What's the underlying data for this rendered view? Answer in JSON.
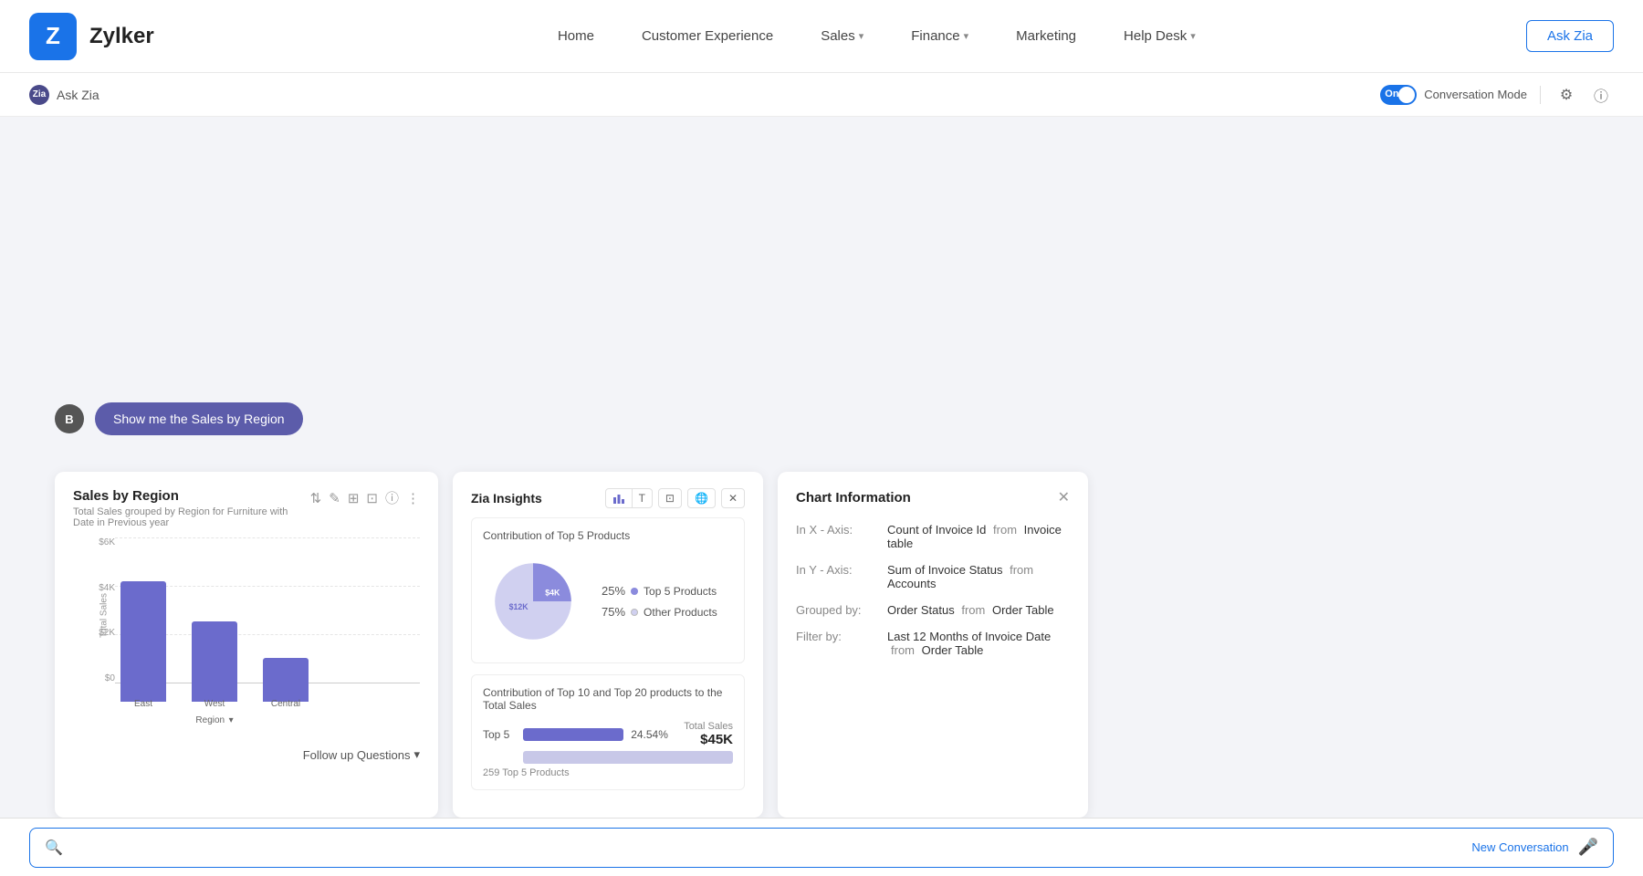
{
  "app": {
    "logo_letter": "Z",
    "name": "Zylker"
  },
  "nav": {
    "items": [
      {
        "label": "Home",
        "has_dropdown": false
      },
      {
        "label": "Customer Experience",
        "has_dropdown": false
      },
      {
        "label": "Sales",
        "has_dropdown": true
      },
      {
        "label": "Finance",
        "has_dropdown": true
      },
      {
        "label": "Marketing",
        "has_dropdown": false
      },
      {
        "label": "Help Desk",
        "has_dropdown": true
      }
    ],
    "ask_zia_btn": "Ask Zia"
  },
  "subheader": {
    "label": "Ask Zia",
    "toggle_on": "On",
    "conv_mode_label": "Conversation Mode"
  },
  "chat": {
    "user_initial": "B",
    "user_message": "Show me the Sales by Region"
  },
  "sales_card": {
    "title": "Sales by Region",
    "subtitle": "Total Sales grouped by Region for Furniture with Date in Previous year",
    "y_labels": [
      "$6K",
      "$4K",
      "$2K",
      "$0"
    ],
    "y_axis_title": "Total Sales",
    "bars": [
      {
        "label": "East",
        "height_pct": 82
      },
      {
        "label": "West\nRegion",
        "height_pct": 55
      },
      {
        "label": "Central",
        "height_pct": 30
      }
    ],
    "follow_up_label": "Follow up Questions"
  },
  "zia_insights": {
    "title": "Zia Insights",
    "pie_section_title": "Contribution of Top 5 Products",
    "pie_segments": [
      {
        "label": "Top 5 Products",
        "pct": 25,
        "color": "#8b8bdd",
        "value": "$4K"
      },
      {
        "label": "Other Products",
        "pct": 75,
        "color": "#d0d0f0",
        "value": "$12K"
      }
    ],
    "bar_section_title": "Contribution of Top 10 and Top 20 products to the Total Sales",
    "top5_label": "Top 5",
    "top5_pct": "24.54%",
    "total_sales_label": "Total Sales",
    "total_sales_value": "$45K",
    "top5_count": "259 Top 5 Products"
  },
  "chart_info": {
    "title": "Chart Information",
    "rows": [
      {
        "label": "In X - Axis:",
        "value": "Count of Invoice Id",
        "from": "from",
        "source": "Invoice table"
      },
      {
        "label": "In Y - Axis:",
        "value": "Sum of Invoice Status",
        "from": "from",
        "source": "Accounts"
      },
      {
        "label": "Grouped by:",
        "value": "Order Status",
        "from": "from",
        "source": "Order Table"
      },
      {
        "label": "Filter by:",
        "value": "Last 12 Months of Invoice Date",
        "from": "from",
        "source": "Order Table"
      }
    ]
  },
  "input": {
    "placeholder": "",
    "new_conversation": "New Conversation"
  }
}
